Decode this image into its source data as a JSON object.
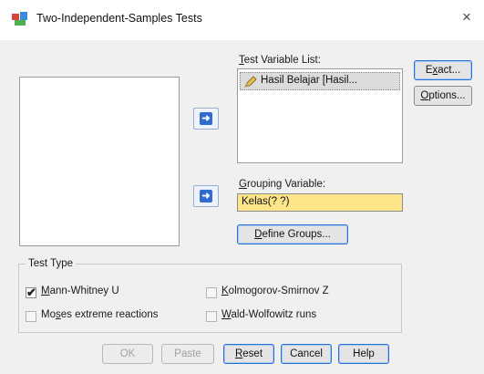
{
  "window": {
    "title": "Two-Independent-Samples Tests",
    "close_glyph": "×"
  },
  "test_variable_list": {
    "label_pre": "",
    "label_u": "T",
    "label_post": "est Variable List:",
    "items": [
      {
        "text": "Hasil Belajar [Hasil...",
        "icon": "pencil-icon"
      }
    ]
  },
  "grouping_variable": {
    "label_pre": "",
    "label_u": "G",
    "label_post": "rouping Variable:",
    "value": "Kelas(? ?)"
  },
  "define_groups": {
    "pre": "",
    "u": "D",
    "post": "efine Groups..."
  },
  "side_buttons": {
    "exact": {
      "pre": "E",
      "u": "x",
      "post": "act..."
    },
    "options": {
      "pre": "",
      "u": "O",
      "post": "ptions..."
    }
  },
  "test_type": {
    "legend": "Test Type",
    "options": [
      {
        "pre": "",
        "u": "M",
        "post": "ann-Whitney U",
        "checked": true
      },
      {
        "pre": "",
        "u": "K",
        "post": "olmogorov-Smirnov Z",
        "checked": false
      },
      {
        "pre": "Mo",
        "u": "s",
        "post": "es extreme reactions",
        "checked": false
      },
      {
        "pre": "",
        "u": "W",
        "post": "ald-Wolfowitz runs",
        "checked": false
      }
    ]
  },
  "footer_buttons": {
    "ok": "OK",
    "paste": "Paste",
    "reset": {
      "pre": "",
      "u": "R",
      "post": "eset"
    },
    "cancel": "Cancel",
    "help": "Help"
  },
  "colors": {
    "grouping_highlight": "#ffe58a",
    "arrow_icon": "#2f6bd0",
    "dialog_bg": "#f0f0f0"
  }
}
